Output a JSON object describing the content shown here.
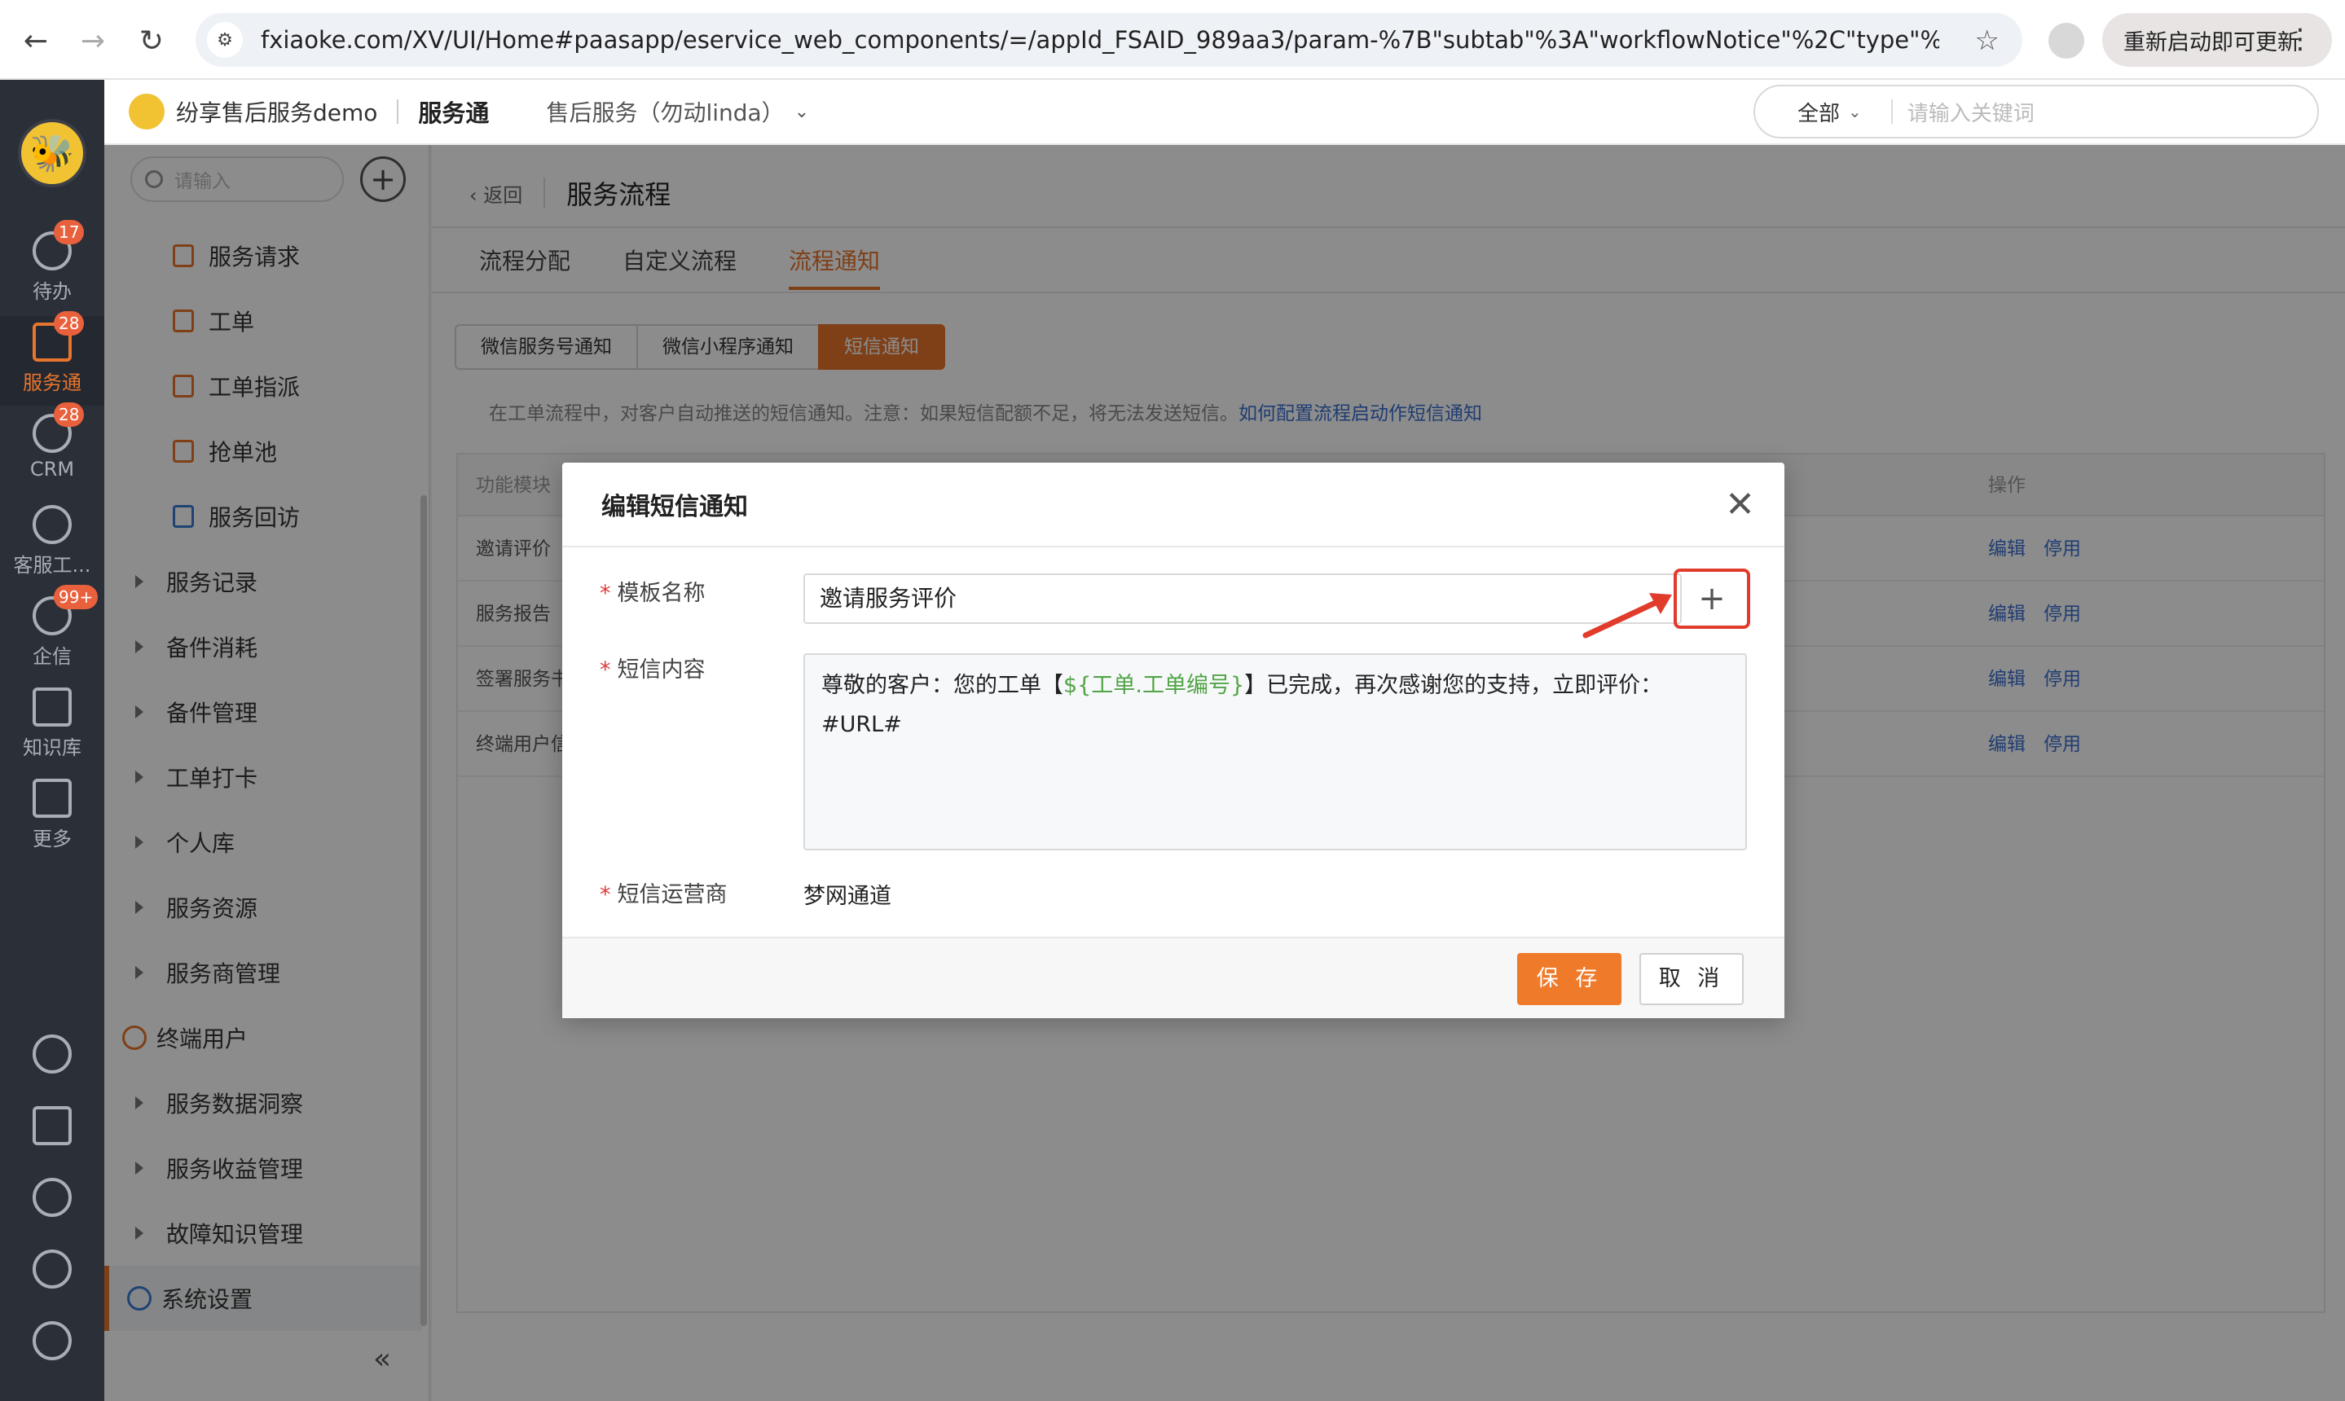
{
  "browser": {
    "url": "fxiaoke.com/XV/UI/Home#paasapp/eservice_web_components/=/appId_FSAID_989aa3/param-%7B\"subtab\"%3A\"workflowNotice\"%2C\"type\"%3A\"proces...",
    "update_label": "重新启动即可更新"
  },
  "rail": {
    "items": [
      {
        "label": "待办",
        "badge": "17"
      },
      {
        "label": "服务通",
        "badge": "28"
      },
      {
        "label": "CRM",
        "badge": "28"
      },
      {
        "label": "客服工...",
        "badge": ""
      },
      {
        "label": "企信",
        "badge": "99+"
      },
      {
        "label": "知识库",
        "badge": ""
      },
      {
        "label": "更多",
        "badge": ""
      }
    ]
  },
  "header": {
    "org": "纷享售后服务demo",
    "app": "服务通",
    "scope": "售后服务（勿动linda）",
    "search_scope": "全部",
    "search_placeholder": "请输入关键词"
  },
  "sidebar": {
    "search_placeholder": "请输入",
    "items": [
      {
        "label": "服务请求"
      },
      {
        "label": "工单"
      },
      {
        "label": "工单指派"
      },
      {
        "label": "抢单池"
      },
      {
        "label": "服务回访"
      },
      {
        "label": "服务记录"
      },
      {
        "label": "备件消耗"
      },
      {
        "label": "备件管理"
      },
      {
        "label": "工单打卡"
      },
      {
        "label": "个人库"
      },
      {
        "label": "服务资源"
      },
      {
        "label": "服务商管理"
      },
      {
        "label": "终端用户"
      },
      {
        "label": "服务数据洞察"
      },
      {
        "label": "服务收益管理"
      },
      {
        "label": "故障知识管理"
      },
      {
        "label": "系统设置"
      }
    ],
    "collapse_glyph": "«"
  },
  "main": {
    "back_label": "返回",
    "title": "服务流程",
    "tabs": [
      "流程分配",
      "自定义流程",
      "流程通知"
    ],
    "segments": [
      "微信服务号通知",
      "微信小程序通知",
      "短信通知"
    ],
    "notice_text": "在工单流程中，对客户自动推送的短信通知。注意：如果短信配额不足，将无法发送短信。",
    "notice_link": "如何配置流程启动作短信通知",
    "table": {
      "col_module": "功能模块",
      "col_ops": "操作",
      "rows": [
        "邀请评价",
        "服务报告",
        "签署服务书",
        "终端用户信"
      ],
      "edit": "编辑",
      "disable": "停用"
    }
  },
  "modal": {
    "title": "编辑短信通知",
    "label_template": "模板名称",
    "template_value": "邀请服务评价",
    "label_content": "短信内容",
    "content_before": "尊敬的客户：您的工单【",
    "content_var": "${工单.工单编号}",
    "content_after": "】已完成，再次感谢您的支持，立即评价：",
    "content_line2": "#URL#",
    "label_carrier": "短信运营商",
    "carrier_value": "梦网通道",
    "save_label": "保 存",
    "cancel_label": "取 消"
  },
  "colors": {
    "accent": "#e8752d",
    "link": "#3a6fcf",
    "highlight": "#e03b2b"
  }
}
